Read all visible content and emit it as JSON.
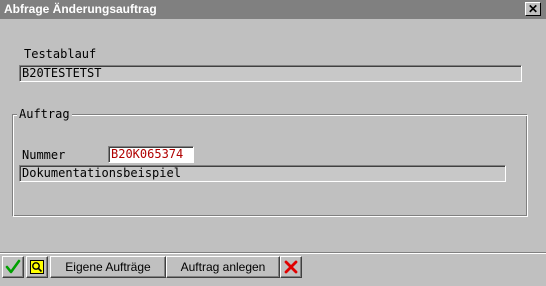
{
  "window": {
    "title": "Abfrage Änderungsauftrag",
    "close_glyph": "✕"
  },
  "testablauf": {
    "label": "Testablauf",
    "value": "B20TESTETST"
  },
  "auftrag_group": {
    "legend": "Auftrag",
    "nummer_label": "Nummer",
    "nummer_value": "B20K065374",
    "description": "Dokumentationsbeispiel"
  },
  "toolbar": {
    "confirm_icon": "check-icon",
    "search_icon": "search-icon",
    "own_orders_label": "Eigene Aufträge",
    "create_order_label": "Auftrag anlegen",
    "cancel_icon": "cancel-x-icon"
  },
  "colors": {
    "titlebar": "#808080",
    "input_text": "#b00000",
    "confirm": "#00a000",
    "cancel": "#e00000"
  }
}
